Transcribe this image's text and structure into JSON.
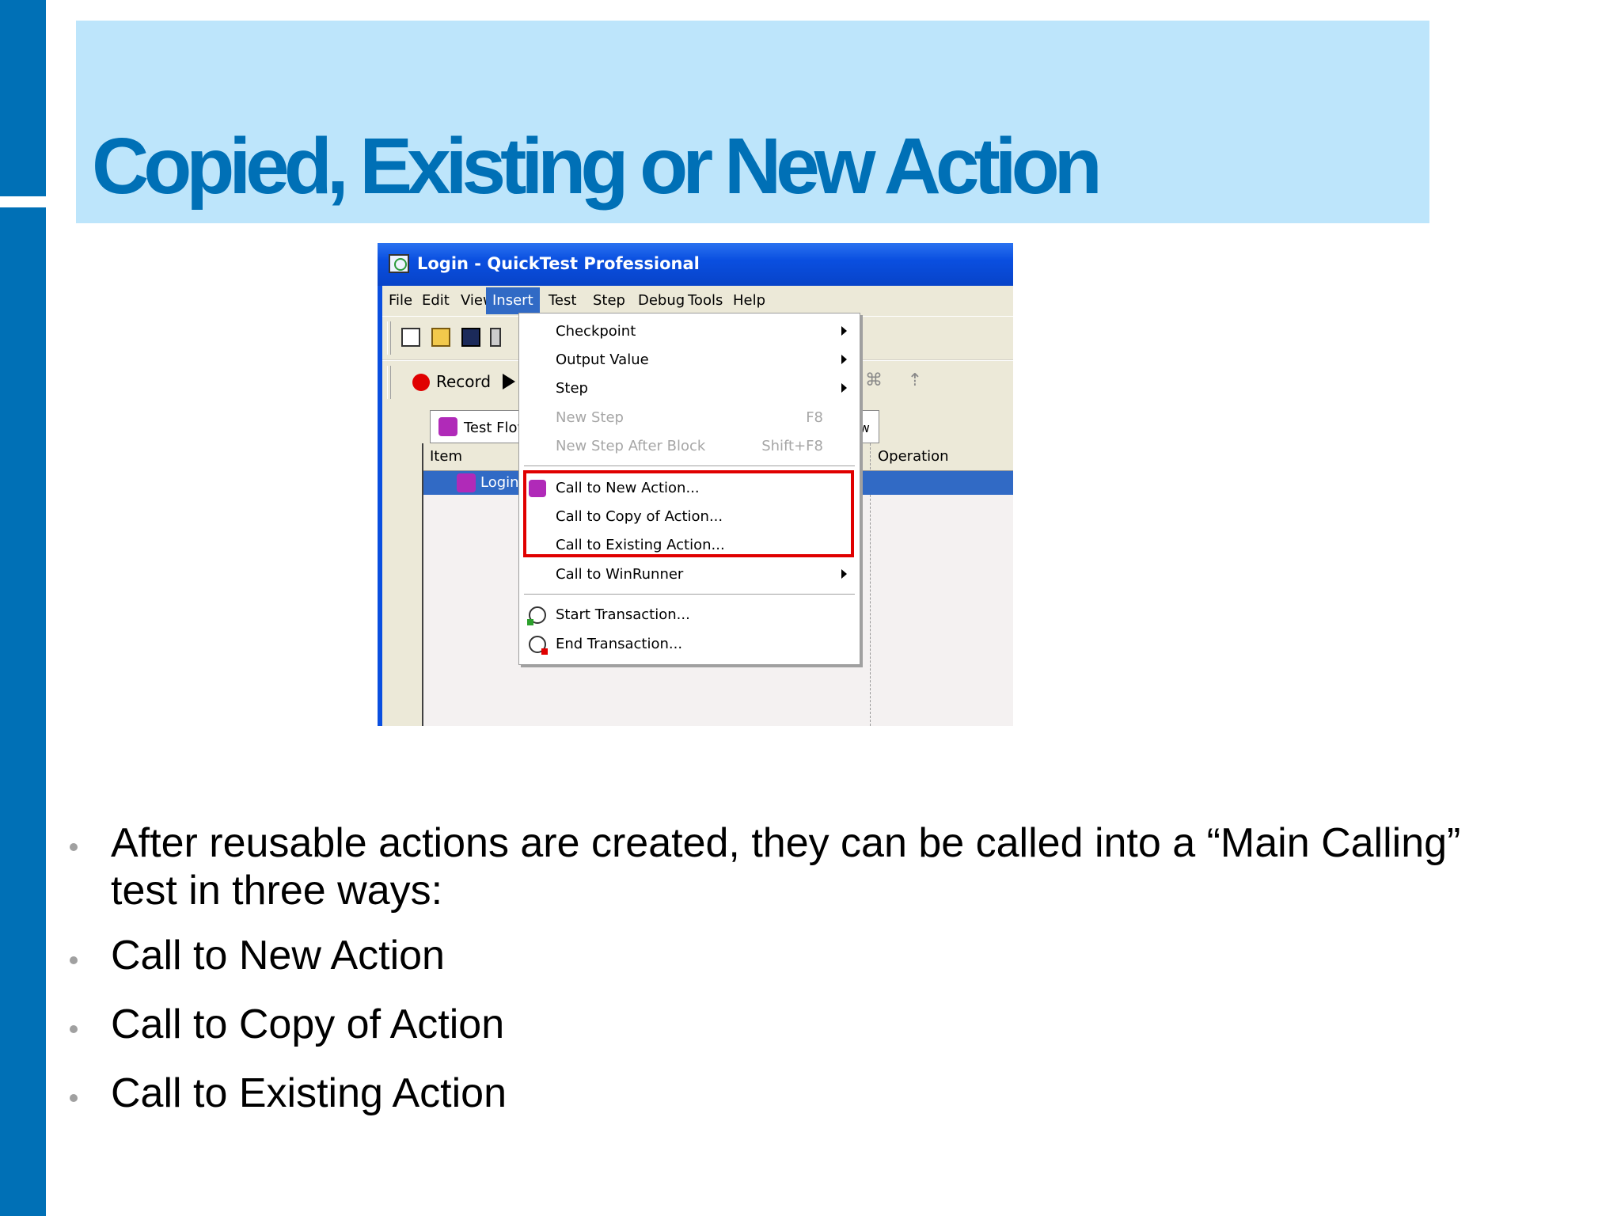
{
  "slide": {
    "title": "Copied, Existing or New Action",
    "bullets": [
      "After reusable actions are created, they can be called into a “Main Calling” test in three ways:",
      "Call to New Action",
      "Call to Copy of Action",
      "Call to Existing Action"
    ]
  },
  "window": {
    "title": "Login - QuickTest Professional",
    "menu": [
      "File",
      "Edit",
      "View",
      "Insert",
      "Test",
      "Step",
      "Debug",
      "Tools",
      "Help"
    ],
    "active_menu": "Insert",
    "toolbar": {
      "record_label": "Record"
    },
    "tabs": {
      "test_flow": "Test Flow",
      "other": "ow"
    },
    "grid": {
      "columns": [
        "Item",
        "Operation"
      ],
      "selected_row": "Login"
    }
  },
  "insert_menu": {
    "items": [
      {
        "label": "Checkpoint",
        "submenu": true
      },
      {
        "label": "Output Value",
        "submenu": true
      },
      {
        "label": "Step",
        "submenu": true
      },
      {
        "label": "New Step",
        "shortcut": "F8",
        "disabled": true
      },
      {
        "label": "New Step After Block",
        "shortcut": "Shift+F8",
        "disabled": true
      },
      {
        "label": "Call to New Action...",
        "icon": "new-action-icon"
      },
      {
        "label": "Call to Copy of Action..."
      },
      {
        "label": "Call to Existing Action..."
      },
      {
        "label": "Call to WinRunner",
        "submenu": true
      },
      {
        "label": "Start Transaction...",
        "icon": "start-transaction-icon"
      },
      {
        "label": "End Transaction...",
        "icon": "end-transaction-icon"
      }
    ],
    "highlight_color": "#e00000"
  },
  "colors": {
    "brand_blue": "#0070b6",
    "title_band": "#bde5fb",
    "selection": "#316ac5"
  }
}
